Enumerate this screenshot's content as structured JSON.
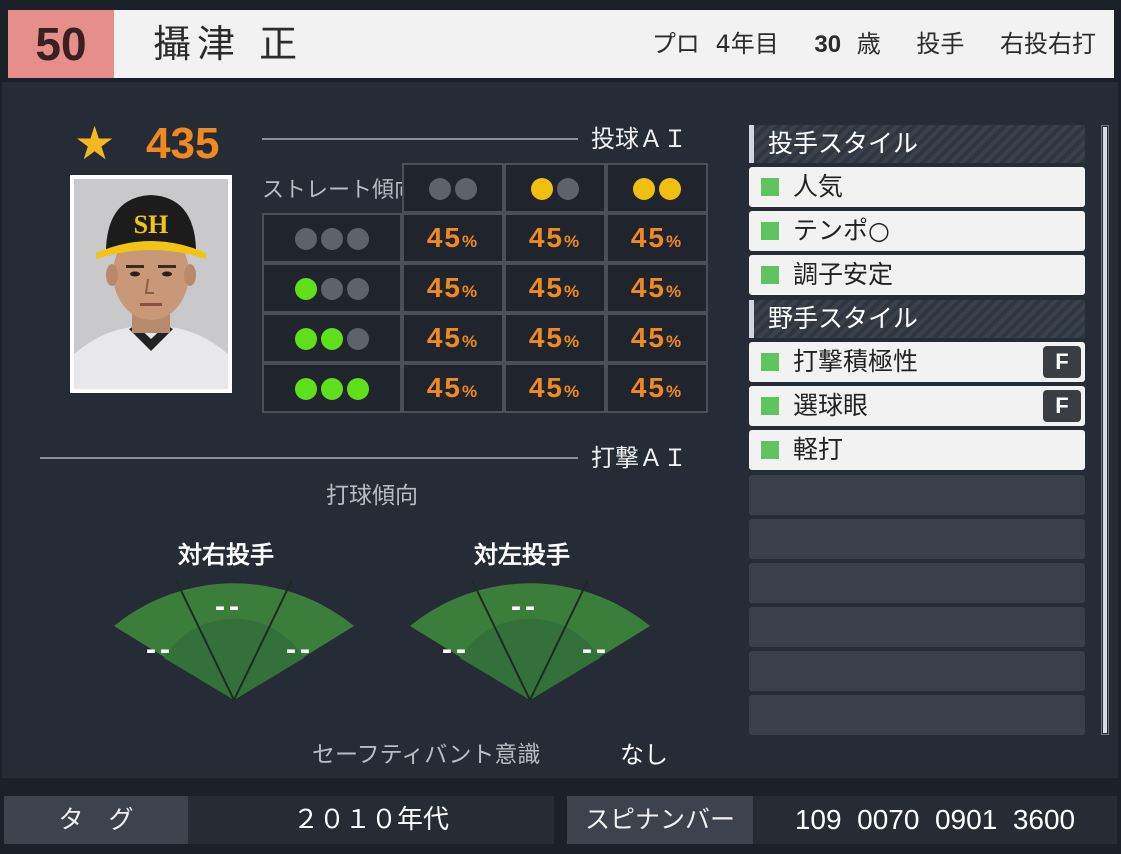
{
  "player": {
    "number": "50",
    "name": "攝津 正",
    "career_prefix": "プロ",
    "career_years": "4年目",
    "age": "30",
    "age_unit": "歳",
    "position": "投手",
    "handedness": "右投右打"
  },
  "rating": {
    "icon": "star-icon",
    "value": "435"
  },
  "pitching_ai": {
    "title": "投球ＡＩ",
    "row_header_label": "ストレート傾向",
    "column_dots": [
      [
        "gray",
        "gray"
      ],
      [
        "yellow",
        "gray"
      ],
      [
        "yellow",
        "yellow"
      ]
    ],
    "rows": [
      {
        "dots": [
          "gray",
          "gray",
          "gray"
        ],
        "values": [
          "45",
          "45",
          "45"
        ]
      },
      {
        "dots": [
          "green",
          "gray",
          "gray"
        ],
        "values": [
          "45",
          "45",
          "45"
        ]
      },
      {
        "dots": [
          "green",
          "green",
          "gray"
        ],
        "values": [
          "45",
          "45",
          "45"
        ]
      },
      {
        "dots": [
          "green",
          "green",
          "green"
        ],
        "values": [
          "45",
          "45",
          "45"
        ]
      }
    ],
    "percent_sign": "%"
  },
  "batting_ai": {
    "title": "打撃ＡＩ",
    "tendency_label": "打球傾向",
    "vs_right": {
      "label": "対右投手",
      "left": "--",
      "center": "--",
      "right": "--"
    },
    "vs_left": {
      "label": "対左投手",
      "left": "--",
      "center": "--",
      "right": "--"
    },
    "bunt_label": "セーフティバント意識",
    "bunt_value": "なし"
  },
  "styles": {
    "pitcher_heading": "投手スタイル",
    "pitcher_items": [
      {
        "label": "人気"
      },
      {
        "label": "テンポ○"
      },
      {
        "label": "調子安定"
      }
    ],
    "fielder_heading": "野手スタイル",
    "fielder_items": [
      {
        "label": "打撃積極性",
        "grade": "F"
      },
      {
        "label": "選球眼",
        "grade": "F"
      },
      {
        "label": "軽打"
      }
    ]
  },
  "footer": {
    "tag_label": "タ　グ",
    "tag_value": "２０１０年代",
    "spinumber_label": "スピナンバー",
    "spinumber_value": "109  0070  0901  3600"
  },
  "colors": {
    "accent_orange": "#f08a20",
    "number_badge": "#e58e8a",
    "dot_gray": "#5d636b",
    "dot_yellow": "#f0c010",
    "dot_green": "#5ee01a",
    "style_square": "#5fc45f",
    "fan_green": "#3b7d3b"
  }
}
